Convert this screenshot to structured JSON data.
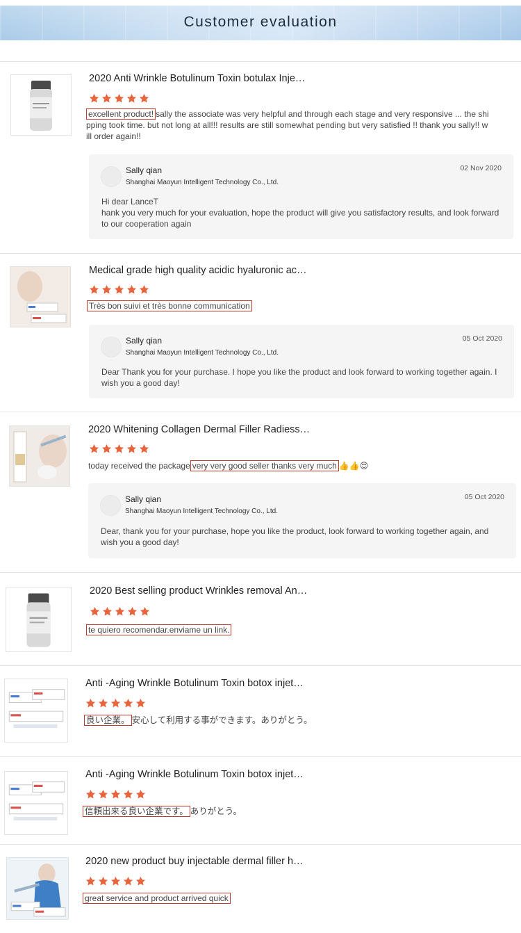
{
  "header": {
    "title": "Customer evaluation"
  },
  "colors": {
    "star": "#e8643c",
    "highlight_border": "#c0392b",
    "reply_bg": "#f5f5f5"
  },
  "reviews": [
    {
      "title": "2020 Anti Wrinkle Botulinum Toxin botulax Inje…",
      "rating": 5,
      "comment_highlight": "excellent product!",
      "comment_rest": "sally the associate was very helpful and through each stage and very responsive ... the shipping took time. but not long at all!!! results are still somewhat pending but very satisfied !! thank you sally!! will order again!!",
      "reply": {
        "name": "Sally qian",
        "company": "Shanghai Maoyun Intelligent Technology Co., Ltd.",
        "date": "02 Nov 2020",
        "greeting": "Hi dear LanceT",
        "text": "hank you very much for your evaluation, hope the product will give you satisfactory results, and look forward to our cooperation again"
      }
    },
    {
      "title": "Medical grade high quality acidic hyaluronic ac…",
      "rating": 5,
      "comment_highlight": "Très bon suivi et très bonne communication",
      "comment_rest": "",
      "reply": {
        "name": "Sally qian",
        "company": "Shanghai Maoyun Intelligent Technology Co., Ltd.",
        "date": "05 Oct 2020",
        "text": "Dear Thank you for your purchase. I hope you like the product and look forward to working together again. I wish you a good day!"
      }
    },
    {
      "title": "2020 Whitening Collagen Dermal Filler Radiess…",
      "rating": 5,
      "comment_before": "today received the package",
      "comment_highlight": "very very good seller thanks very much",
      "comment_emoji": "👍👍😍",
      "reply": {
        "name": "Sally qian",
        "company": "Shanghai Maoyun Intelligent Technology Co., Ltd.",
        "date": "05 Oct 2020",
        "text": "Dear, thank you for your purchase, hope you like the product, look forward to working together again, and wish you a good day!"
      }
    },
    {
      "title": "2020 Best selling product Wrinkles removal An…",
      "rating": 5,
      "comment_highlight": "te quiero recomendar.enviame un link."
    },
    {
      "title": "Anti -Aging Wrinkle Botulinum Toxin botox injet…",
      "rating": 5,
      "comment_highlight": "良い企業。",
      "comment_rest": "安心して利用する事ができます。ありがとう。"
    },
    {
      "title": "Anti -Aging Wrinkle Botulinum Toxin botox injet…",
      "rating": 5,
      "comment_highlight": "信頼出来る良い企業です。",
      "comment_rest": "ありがとう。"
    },
    {
      "title": "2020 new product buy injectable dermal filler h…",
      "rating": 5,
      "comment_highlight": "great service and product arrived quick"
    }
  ]
}
